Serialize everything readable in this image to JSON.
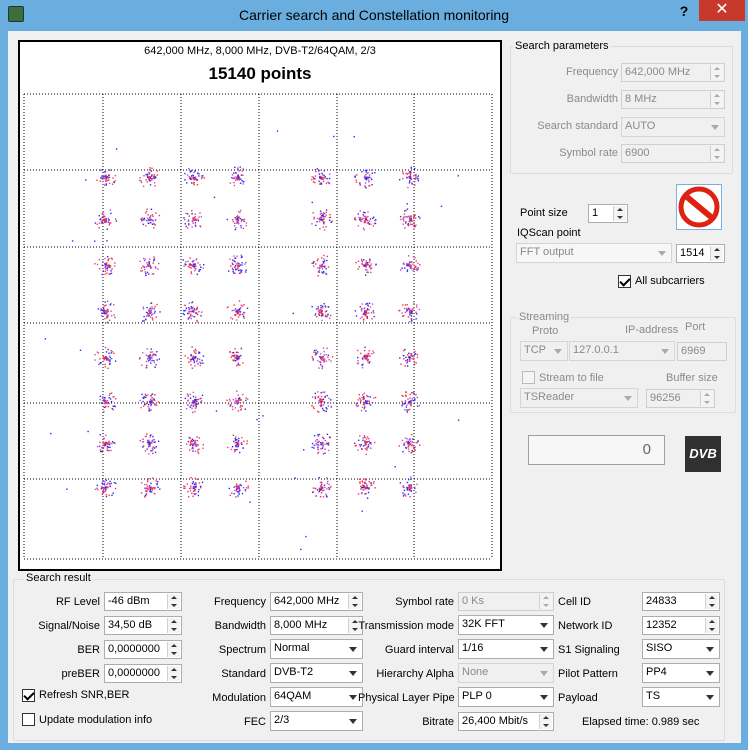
{
  "window": {
    "title": "Carrier search and Constellation monitoring",
    "help": "?",
    "close": "✕"
  },
  "plot": {
    "header": "642,000 MHz, 8,000 MHz, DVB-T2/64QAM, 2/3",
    "points_label": "15140 points",
    "dot_colors": [
      "#2a2aff",
      "#ff3030",
      "#c050c0"
    ]
  },
  "search_parameters": {
    "title": "Search parameters",
    "frequency": {
      "label": "Frequency",
      "value": "642,000 MHz"
    },
    "bandwidth": {
      "label": "Bandwidth",
      "value": "8 MHz"
    },
    "search_standard": {
      "label": "Search standard",
      "value": "AUTO"
    },
    "symbol_rate": {
      "label": "Symbol rate",
      "value": "6900"
    }
  },
  "display": {
    "point_size_label": "Point size",
    "point_size": "1",
    "iqscan_label": "IQScan point",
    "iqscan_value": "FFT output",
    "iqscan_count": "1514",
    "all_subcarriers": "All subcarriers"
  },
  "streaming": {
    "title": "Streaming",
    "proto_label": "Proto",
    "proto": "TCP",
    "ip_label": "IP-address",
    "ip": "127.0.0.1",
    "port_label": "Port",
    "port": "6969",
    "stream_to_file": "Stream to file",
    "buffer_label": "Buffer size",
    "reader": "TSReader",
    "buffer": "96256"
  },
  "progress_glyph": "0",
  "logo": "DVB",
  "search_result": {
    "title": "Search result",
    "rf_level": {
      "label": "RF Level",
      "value": "-46 dBm"
    },
    "signal_noise": {
      "label": "Signal/Noise",
      "value": "34,50 dB"
    },
    "ber": {
      "label": "BER",
      "value": "0,0000000"
    },
    "preber": {
      "label": "preBER",
      "value": "0,0000000"
    },
    "refresh": "Refresh SNR,BER",
    "update_mod": "Update modulation info",
    "frequency": {
      "label": "Frequency",
      "value": "642,000 MHz"
    },
    "bandwidth": {
      "label": "Bandwidth",
      "value": "8,000 MHz"
    },
    "spectrum": {
      "label": "Spectrum",
      "value": "Normal"
    },
    "standard": {
      "label": "Standard",
      "value": "DVB-T2"
    },
    "modulation": {
      "label": "Modulation",
      "value": "64QAM"
    },
    "fec": {
      "label": "FEC",
      "value": "2/3"
    },
    "symbol_rate": {
      "label": "Symbol rate",
      "value": "0 Ks"
    },
    "transmission_mode": {
      "label": "Transmission mode",
      "value": "32K FFT"
    },
    "guard_interval": {
      "label": "Guard interval",
      "value": "1/16"
    },
    "hierarchy_alpha": {
      "label": "Hierarchy Alpha",
      "value": "None"
    },
    "plp": {
      "label": "Physical Layer Pipe",
      "value": "PLP 0"
    },
    "bitrate": {
      "label": "Bitrate",
      "value": "26,400 Mbit/s"
    },
    "cell_id": {
      "label": "Cell ID",
      "value": "24833"
    },
    "network_id": {
      "label": "Network ID",
      "value": "12352"
    },
    "s1_signaling": {
      "label": "S1 Signaling",
      "value": "SISO"
    },
    "pilot_pattern": {
      "label": "Pilot Pattern",
      "value": "PP4"
    },
    "payload": {
      "label": "Payload",
      "value": "TS"
    },
    "elapsed": "Elapsed time: 0.989 sec"
  }
}
